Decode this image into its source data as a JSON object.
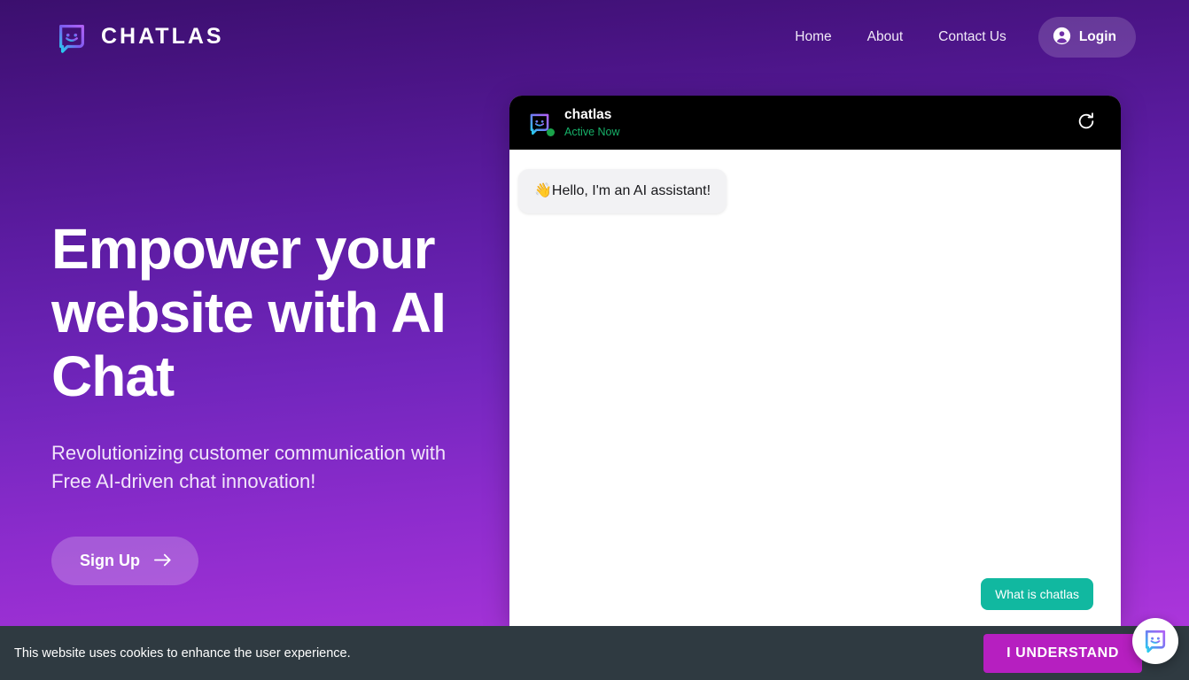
{
  "brand": {
    "name": "CHATLAS",
    "logo_icon": "chatlas-bot-face-logo"
  },
  "nav": {
    "items": [
      {
        "label": "Home"
      },
      {
        "label": "About"
      },
      {
        "label": "Contact Us"
      }
    ],
    "login": {
      "label": "Login",
      "icon": "user-circle-icon"
    }
  },
  "hero": {
    "headline": "Empower your website with AI Chat",
    "subtitle": "Revolutionizing customer communication with Free AI-driven chat innovation!",
    "cta": {
      "label": "Sign Up",
      "icon": "arrow-right-icon"
    }
  },
  "chat_widget": {
    "header": {
      "title": "chatlas",
      "status": "Active Now",
      "avatar_icon": "chatlas-bot-face-logo",
      "online_indicator": true,
      "refresh_icon": "refresh-icon"
    },
    "messages": [
      {
        "sender": "bot",
        "text": "👋Hello, I'm an AI assistant!"
      }
    ],
    "quick_replies": [
      {
        "label": "What is chatlas"
      }
    ]
  },
  "cookie_banner": {
    "text": "This website uses cookies to enhance the user experience.",
    "accept_label": "I UNDERSTAND"
  },
  "chat_launcher": {
    "icon": "chatlas-bot-face-logo"
  },
  "colors": {
    "bg_gradient_top": "#3b0f6e",
    "bg_gradient_bottom": "#b43ae0",
    "chat_header_bg": "#000000",
    "status_green": "#17b169",
    "quick_reply_teal": "#11b8a0",
    "cookie_bar_bg": "#2f3a41",
    "cookie_btn_magenta": "#b61fc0"
  }
}
